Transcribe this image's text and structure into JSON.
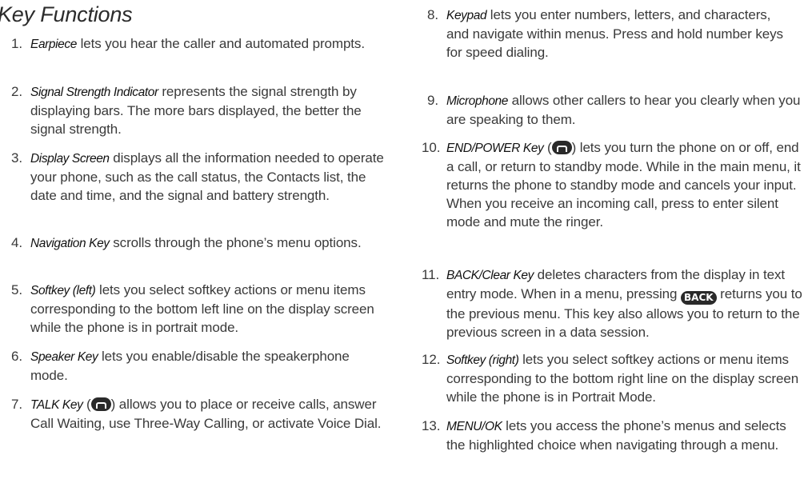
{
  "heading": "Key Functions",
  "items": [
    {
      "num": "1.",
      "term": "Earpiece",
      "text": " lets you hear the caller and automated prompts."
    },
    {
      "num": "2.",
      "term": "Signal Strength Indicator",
      "text": " represents the signal strength by displaying bars. The more bars displayed, the better the signal strength."
    },
    {
      "num": "3.",
      "term": "Display Screen",
      "text": " displays all the information needed to operate your phone, such as the call status, the Contacts list, the date and time, and the signal and battery strength."
    },
    {
      "num": "4.",
      "term": "Navigation Key",
      "text": " scrolls through the phone’s menu options."
    },
    {
      "num": "5.",
      "term": "Softkey (left)",
      "text": " lets you select softkey actions or menu items corresponding to the bottom left line on the display screen while the phone is in portrait mode."
    },
    {
      "num": "6.",
      "term": "Speaker Key",
      "text": " lets you enable/disable the speakerphone mode."
    },
    {
      "num": "7.",
      "term": "TALK Key",
      "pre": " (",
      "post": ") allows you to place or receive calls, answer Call Waiting, use Three-Way Calling, or activate Voice Dial."
    },
    {
      "num": "8.",
      "term": "Keypad",
      "text": " lets you enter numbers, letters, and characters, and navigate within menus. Press and hold number keys for speed dialing."
    },
    {
      "num": "9.",
      "term": "Microphone",
      "text": " allows other callers to hear you clearly when you are speaking to them."
    },
    {
      "num": "10.",
      "term": "END/POWER Key",
      "pre": " (",
      "post": ") lets you turn the phone on or off, end a call, or return to standby mode. While in the main menu, it returns the phone to standby mode and cancels your input. When you receive an incoming call, press to enter silent mode and mute the ringer."
    },
    {
      "num": "11.",
      "term": "BACK/Clear Key",
      "pre": " deletes characters from the display in text entry mode. When in a menu, pressing ",
      "icon_label": "BACK",
      "post": " returns you to the previous menu. This key also allows you to return to the previous screen in a data session."
    },
    {
      "num": "12.",
      "term": "Softkey (right)",
      "text": " lets you select softkey actions or menu items corresponding to the bottom right line on the display screen while the phone is in Portrait Mode."
    },
    {
      "num": "13.",
      "term": "MENU/OK",
      "text": " lets you access the phone’s menus and selects the highlighted choice when navigating through a menu."
    }
  ]
}
